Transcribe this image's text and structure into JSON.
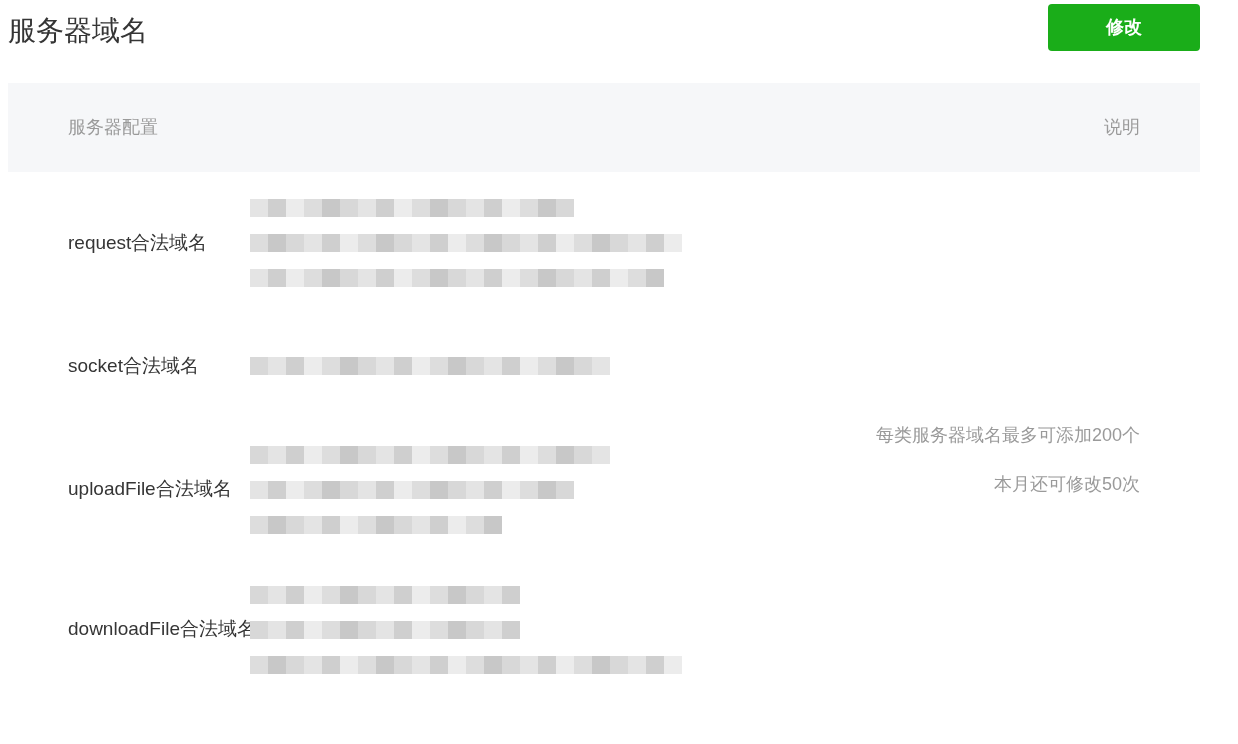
{
  "title": "服务器域名",
  "edit_button": "修改",
  "table": {
    "columns": [
      "服务器配置",
      "说明"
    ],
    "rows": [
      {
        "label": "request合法域名",
        "value_lines": [
          {
            "kind": "redacted"
          },
          {
            "kind": "redacted"
          },
          {
            "kind": "redacted"
          }
        ]
      },
      {
        "label": "socket合法域名",
        "value_lines": [
          {
            "kind": "redacted"
          }
        ]
      },
      {
        "label": "uploadFile合法域名",
        "value_lines": [
          {
            "kind": "redacted"
          },
          {
            "kind": "redacted"
          },
          {
            "kind": "redacted"
          }
        ]
      },
      {
        "label": "downloadFile合法域名",
        "value_lines": [
          {
            "kind": "redacted"
          },
          {
            "kind": "redacted"
          },
          {
            "kind": "redacted"
          }
        ]
      }
    ],
    "notes": [
      "每类服务器域名最多可添加200个",
      "本月还可修改50次"
    ]
  }
}
